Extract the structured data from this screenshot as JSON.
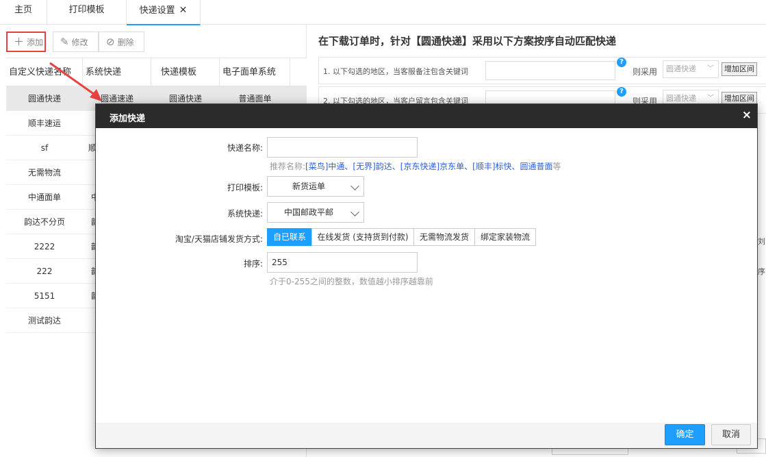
{
  "tabs": [
    {
      "label": "主页"
    },
    {
      "label": "打印模板"
    },
    {
      "label": "快递设置",
      "close": "✕"
    }
  ],
  "toolbar": {
    "add_label": "添加",
    "edit_label": "修改",
    "delete_label": "删除"
  },
  "grid": {
    "columns": [
      "自定义快递名称",
      "系统快递",
      "快递模板",
      "电子面单系统"
    ],
    "rows": [
      {
        "name": "圆通快递",
        "system": "圆通速递",
        "template": "圆通快递",
        "esystem": "普通面单"
      },
      {
        "name": "顺丰速运",
        "system": "",
        "template": "",
        "esystem": ""
      },
      {
        "name": "sf",
        "system": "顺",
        "template": "",
        "esystem": ""
      },
      {
        "name": "无需物流",
        "system": "",
        "template": "",
        "esystem": ""
      },
      {
        "name": "中通面单",
        "system": "中",
        "template": "",
        "esystem": ""
      },
      {
        "name": "韵达不分页",
        "system": "韵",
        "template": "",
        "esystem": ""
      },
      {
        "name": "2222",
        "system": "韵",
        "template": "",
        "esystem": ""
      },
      {
        "name": "222",
        "system": "韵",
        "template": "",
        "esystem": ""
      },
      {
        "name": "5151",
        "system": "韵",
        "template": "",
        "esystem": ""
      },
      {
        "name": "测试韵达",
        "system": "",
        "template": "",
        "esystem": ""
      }
    ]
  },
  "right": {
    "title": "在下载订单时，针对【圆通快递】采用以下方案按序自动匹配快递",
    "rules": [
      {
        "text": "1. 以下勾选的地区，当客服备注包含关键词",
        "use_label": "则采用",
        "select_value": "圆通快递",
        "add_button": "增加区间"
      },
      {
        "text": "2. 以下勾选的地区，当客户留言包含关键词",
        "use_label": "则采用",
        "select_value": "圆通快递",
        "add_button": "增加区间"
      }
    ],
    "peek_text_1": "刘",
    "peek_text_2": "序"
  },
  "modal": {
    "title": "添加快递",
    "close": "×",
    "fields": {
      "name_label": "快递名称:",
      "name_value": "",
      "name_hint_prefix": "推荐名称:",
      "name_hint_links": "[菜鸟]中通、[无界]韵达、[京东快递]京东单、[顺丰]标快、圆通普面",
      "name_hint_suffix": "等",
      "template_label": "打印模板:",
      "template_value": "新货运单",
      "system_label": "系统快递:",
      "system_value": "中国邮政平邮",
      "ship_label": "淘宝/天猫店铺发货方式:",
      "ship_options": [
        "自已联系",
        "在线发货 (支持货到付款)",
        "无需物流发货",
        "绑定家装物流"
      ],
      "order_label": "排序:",
      "order_value": "255",
      "order_hint": "介于0-255之间的整数，数值越小排序越靠前"
    },
    "ok_label": "确定",
    "cancel_label": "取消"
  },
  "colors": {
    "primary": "#1e9fff",
    "modal_header": "#2b2b2b",
    "highlight_border": "#e94040",
    "link": "#2b5fd9"
  }
}
